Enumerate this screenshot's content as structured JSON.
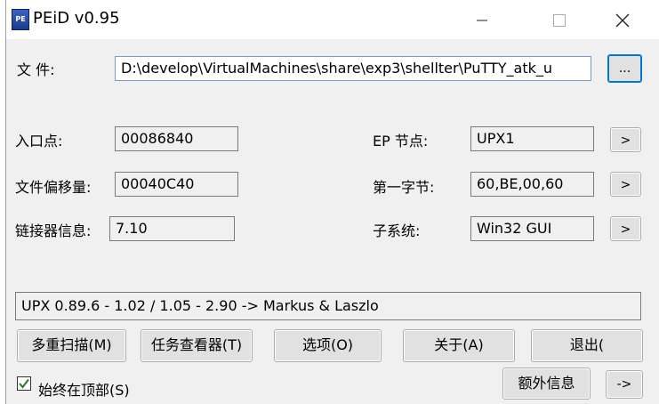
{
  "window": {
    "title": "PEiD v0.95",
    "icon": "peid-app-icon",
    "controls": [
      "minimize-icon",
      "maximize-icon",
      "close-icon"
    ]
  },
  "file": {
    "label": "文  件:",
    "path": "D:\\develop\\VirtualMachines\\share\\exp3\\shellter\\PuTTY_atk_u",
    "browse_label": "..."
  },
  "info": {
    "entry_point": {
      "label": "入口点:",
      "value": "00086840"
    },
    "file_offset": {
      "label": "文件偏移量:",
      "value": "00040C40"
    },
    "linker_info": {
      "label": "链接器信息:",
      "value": "7.10"
    },
    "ep_section": {
      "label": "EP 节点:",
      "value": "UPX1",
      "button": ">"
    },
    "first_bytes": {
      "label": "第一字节:",
      "value": "60,BE,00,60",
      "button": ">"
    },
    "subsystem": {
      "label": "子系统:",
      "value": "Win32 GUI",
      "button": ">"
    }
  },
  "result": "UPX 0.89.6 - 1.02 / 1.05 - 2.90 -> Markus & Laszlo",
  "buttons": {
    "multi_scan": "多重扫描(M)",
    "task_viewer": "任务查看器(T)",
    "options": "选项(O)",
    "about": "关于(A)",
    "exit": "退出("
  },
  "bottom": {
    "always_on_top": "始终在顶部(S)",
    "always_on_top_checked": true,
    "extra_info": "额外信息",
    "more": "->"
  }
}
